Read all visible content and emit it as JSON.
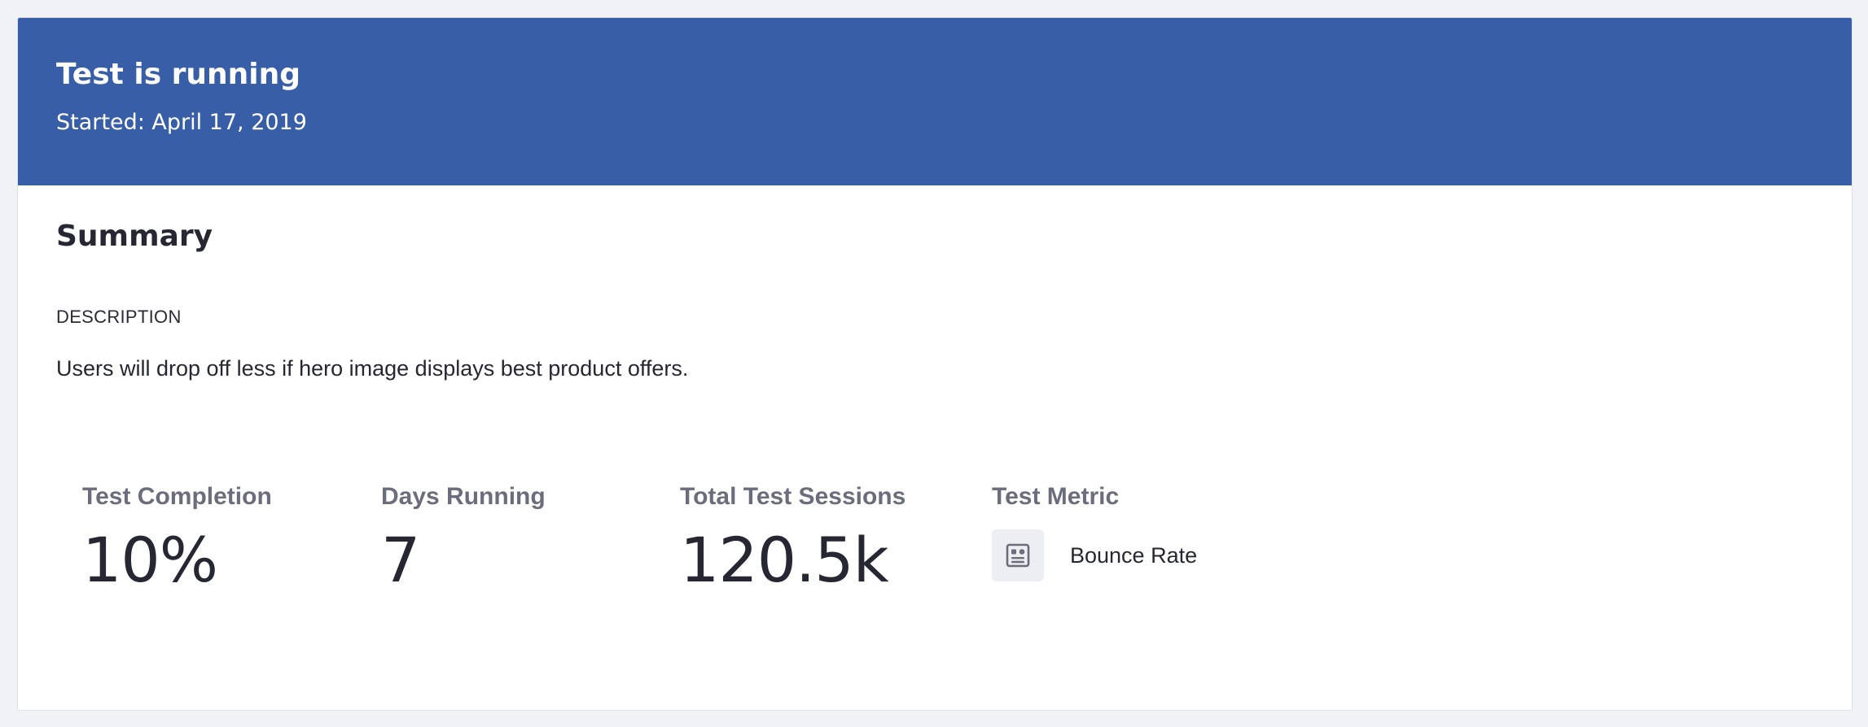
{
  "header": {
    "title": "Test is running",
    "subtitle": "Started: April 17, 2019",
    "background_color": "#385ea8"
  },
  "summary": {
    "title": "Summary",
    "description_label": "DESCRIPTION",
    "description": "Users will drop off less if hero image displays best product offers."
  },
  "stats": [
    {
      "label": "Test Completion",
      "value": "10%"
    },
    {
      "label": "Days Running",
      "value": "7"
    },
    {
      "label": "Total Test Sessions",
      "value": "120.5k"
    }
  ],
  "metric": {
    "label": "Test Metric",
    "name": "Bounce Rate",
    "icon": "article-icon"
  }
}
